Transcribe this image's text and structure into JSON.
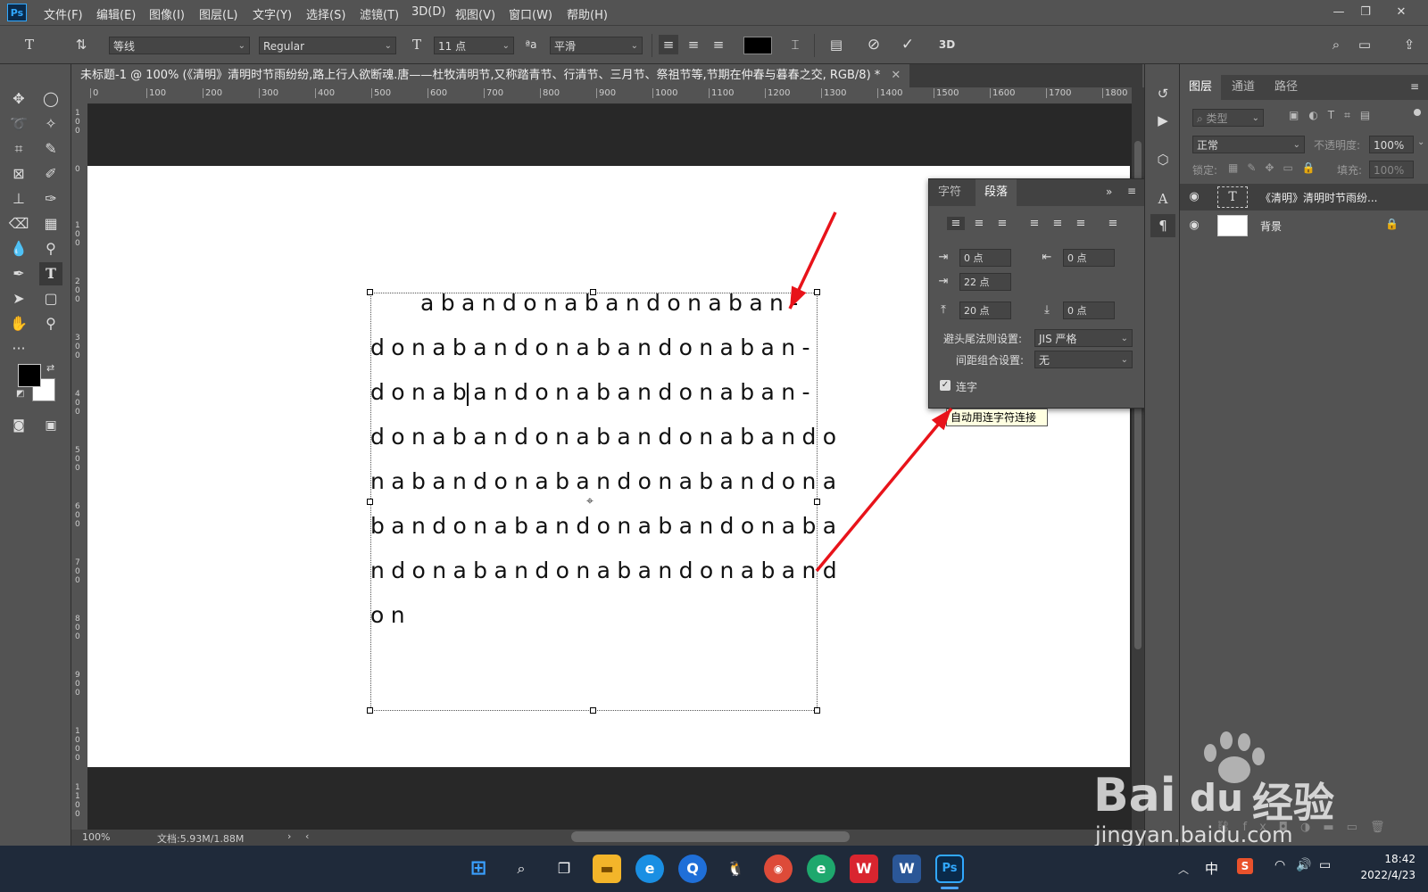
{
  "app": {
    "logo": "Ps"
  },
  "menu": [
    "文件(F)",
    "编辑(E)",
    "图像(I)",
    "图层(L)",
    "文字(Y)",
    "选择(S)",
    "滤镜(T)",
    "3D(D)",
    "视图(V)",
    "窗口(W)",
    "帮助(H)"
  ],
  "options": {
    "font_family": "等线",
    "font_style": "Regular",
    "font_size": "11 点",
    "antialias": "平滑",
    "color_swatch": "#000000",
    "aa_label": "ªa"
  },
  "document": {
    "tab_title": "未标题-1 @ 100% (《清明》清明时节雨纷纷,路上行人欲断魂.唐——杜牧清明节,又称踏青节、行清节、三月节、祭祖节等,节期在仲春与暮春之交, RGB/8) *",
    "ruler_top": [
      "0",
      "100",
      "200",
      "300",
      "400",
      "500",
      "600",
      "700",
      "800",
      "900",
      "1000",
      "1100",
      "1200",
      "1300",
      "1400",
      "1500",
      "1600",
      "1700",
      "1800"
    ],
    "ruler_left": [
      "1\n0\n0",
      "0",
      "1\n0\n0",
      "2\n0\n0",
      "3\n0\n0",
      "4\n0\n0",
      "5\n0\n0",
      "6\n0\n0",
      "7\n0\n0",
      "8\n0\n0",
      "9\n0\n0",
      "1\n0\n0\n0",
      "1\n1\n0\n0"
    ],
    "text_lines": [
      "abandonabandonaban-",
      "donabandonabandonaban-",
      "donabandonabandonaban-",
      "donabandonabandonabando",
      "nabandonabandonabandona",
      "bandonabandonabandonaba",
      "ndonabandonabandonaband",
      "on"
    ]
  },
  "status": {
    "zoom": "100%",
    "doc_info": "文档:5.93M/1.88M"
  },
  "paragraph_panel": {
    "tab_character": "字符",
    "tab_paragraph": "段落",
    "indent_left": "0 点",
    "indent_right": "0 点",
    "indent_first": "22 点",
    "space_before": "20 点",
    "space_after": "0 点",
    "kinsoku_label": "避头尾法则设置:",
    "kinsoku_value": "JIS 严格",
    "mojikumi_label": "间距组合设置:",
    "mojikumi_value": "无",
    "hyphenate_label": "连字",
    "hyphenate_checked": true,
    "tooltip": "自动用连字符连接"
  },
  "layers_panel": {
    "tabs": [
      "图层",
      "通道",
      "路径"
    ],
    "filter_placeholder": "类型",
    "blend_mode": "正常",
    "opacity_label": "不透明度:",
    "opacity_value": "100%",
    "lock_label": "锁定:",
    "fill_label": "填充:",
    "fill_value": "100%",
    "layers": [
      {
        "name": "《清明》清明时节雨纷...",
        "type": "text"
      },
      {
        "name": "背景",
        "type": "background"
      }
    ]
  },
  "taskbar": {
    "time": "18:42",
    "date": "2022/4/23",
    "ime": "中"
  },
  "watermark": {
    "brand": "Bai",
    "brand2": "du",
    "cn": "经验",
    "url": "jingyan.baidu.com"
  },
  "colors": {
    "arrow": "#e8131a",
    "accent": "#31a8ff"
  }
}
